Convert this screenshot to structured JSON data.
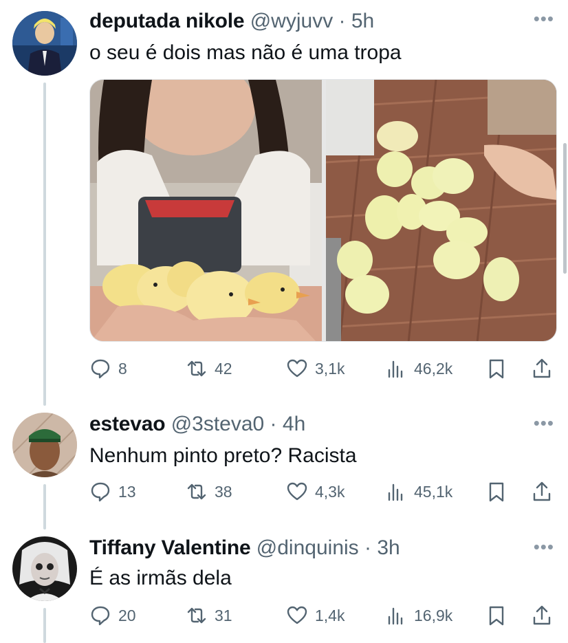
{
  "tweets": [
    {
      "name": "deputada nikole",
      "handle": "@wyjuvv",
      "time": "5h",
      "text": "o seu é dois mas não é uma tropa",
      "stats": {
        "replies": "8",
        "retweets": "42",
        "likes": "3,1k",
        "views": "46,2k"
      }
    },
    {
      "name": "estevao",
      "handle": "@3steva0",
      "time": "4h",
      "text": "Nenhum pinto preto? Racista",
      "stats": {
        "replies": "13",
        "retweets": "38",
        "likes": "4,3k",
        "views": "45,1k"
      }
    },
    {
      "name": "Tiffany Valentine",
      "handle": "@dinquinis",
      "time": "3h",
      "text": "É as irmãs dela",
      "stats": {
        "replies": "20",
        "retweets": "31",
        "likes": "1,4k",
        "views": "16,9k"
      }
    }
  ],
  "icons": {
    "reply": "speech-bubble",
    "retweet": "retweet-arrows",
    "like": "heart",
    "views": "bar-chart",
    "bookmark": "bookmark",
    "share": "share-upload",
    "more": "ellipsis"
  },
  "separator": " · ",
  "more_glyph": "•••",
  "colors": {
    "text": "#0f1419",
    "secondary": "#536471",
    "thread_line": "#cfd9de"
  }
}
